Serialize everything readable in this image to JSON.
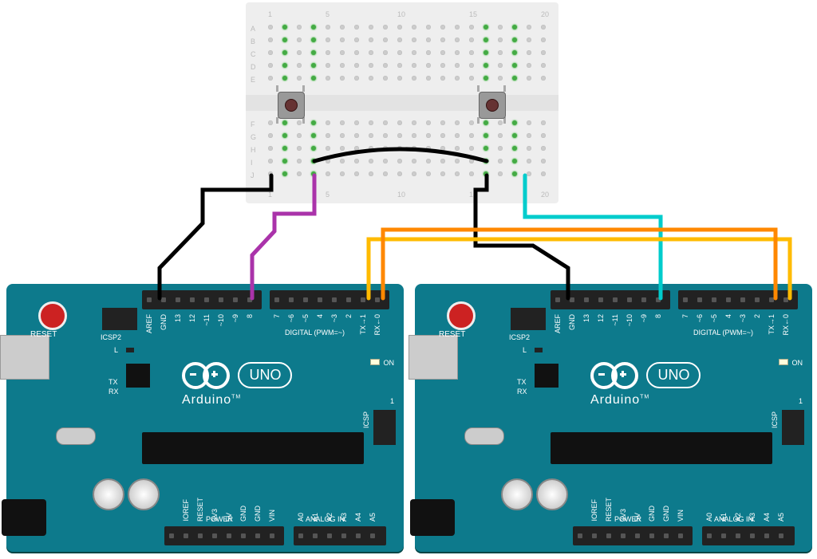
{
  "breadboard": {
    "rows_top": [
      "A",
      "B",
      "C",
      "D",
      "E"
    ],
    "rows_bottom": [
      "F",
      "G",
      "H",
      "I",
      "J"
    ],
    "col_markers": [
      "1",
      "5",
      "10",
      "15",
      "20"
    ]
  },
  "components": {
    "button1": {
      "type": "tactile_pushbutton",
      "position": "cols 2-4, rows E-F"
    },
    "button2": {
      "type": "tactile_pushbutton",
      "position": "cols 16-18, rows E-F"
    }
  },
  "boards": {
    "left": {
      "model": "Arduino UNO",
      "brand": "Arduino",
      "uno_text": "UNO",
      "reset_label": "RESET",
      "icsp2_label": "ICSP2",
      "icsp_label": "ICSP",
      "on_label": "ON",
      "l_label": "L",
      "tx_label": "TX",
      "rx_label": "RX",
      "digital_label": "DIGITAL (PWM=~)",
      "power_label": "POWER",
      "analog_label": "ANALOG IN",
      "one_label": "1",
      "top_pins_left": [
        "",
        "IOREF",
        "RESET",
        "3V3",
        "5V",
        "GND",
        "GND",
        "VIN"
      ],
      "top_pins_right": [
        "A0",
        "A1",
        "A2",
        "A3",
        "A4",
        "A5"
      ],
      "digital_left": [
        "AREF",
        "GND",
        "13",
        "12",
        "~11",
        "~10",
        "~9",
        "8"
      ],
      "digital_right": [
        "7",
        "~6",
        "~5",
        "4",
        "~3",
        "2",
        "TX→1",
        "RX←0"
      ]
    },
    "right": {
      "model": "Arduino UNO",
      "brand": "Arduino",
      "uno_text": "UNO",
      "reset_label": "RESET",
      "icsp2_label": "ICSP2",
      "icsp_label": "ICSP",
      "on_label": "ON",
      "l_label": "L",
      "tx_label": "TX",
      "rx_label": "RX",
      "digital_label": "DIGITAL (PWM=~)",
      "power_label": "POWER",
      "analog_label": "ANALOG IN",
      "one_label": "1",
      "top_pins_left": [
        "",
        "IOREF",
        "RESET",
        "3V3",
        "5V",
        "GND",
        "GND",
        "VIN"
      ],
      "top_pins_right": [
        "A0",
        "A1",
        "A2",
        "A3",
        "A4",
        "A5"
      ],
      "digital_left": [
        "AREF",
        "GND",
        "13",
        "12",
        "~11",
        "~10",
        "~9",
        "8"
      ],
      "digital_right": [
        "7",
        "~6",
        "~5",
        "4",
        "~3",
        "2",
        "TX→1",
        "RX←0"
      ]
    }
  },
  "wires": [
    {
      "name": "gnd-left-to-btn1",
      "color": "#000",
      "from": "Arduino-left GND",
      "to": "breadboard J2"
    },
    {
      "name": "d8-left-to-btn1",
      "color": "#a3a",
      "from": "Arduino-left D8",
      "to": "breadboard J4"
    },
    {
      "name": "bb-gnd-link",
      "color": "#000",
      "from": "breadboard I4 area",
      "to": "breadboard I16"
    },
    {
      "name": "gnd-right-to-bb",
      "color": "#000",
      "from": "Arduino-right GND",
      "to": "breadboard J16 area"
    },
    {
      "name": "d8-right-to-btn2",
      "color": "#0cc",
      "from": "Arduino-right D8",
      "to": "breadboard J18"
    },
    {
      "name": "tx-left-to-rx-right",
      "color": "#fb0",
      "from": "Arduino-left TX1",
      "to": "Arduino-right RX0"
    },
    {
      "name": "rx-left-to-tx-right",
      "color": "#f80",
      "from": "Arduino-left RX0",
      "to": "Arduino-right TX1"
    }
  ]
}
